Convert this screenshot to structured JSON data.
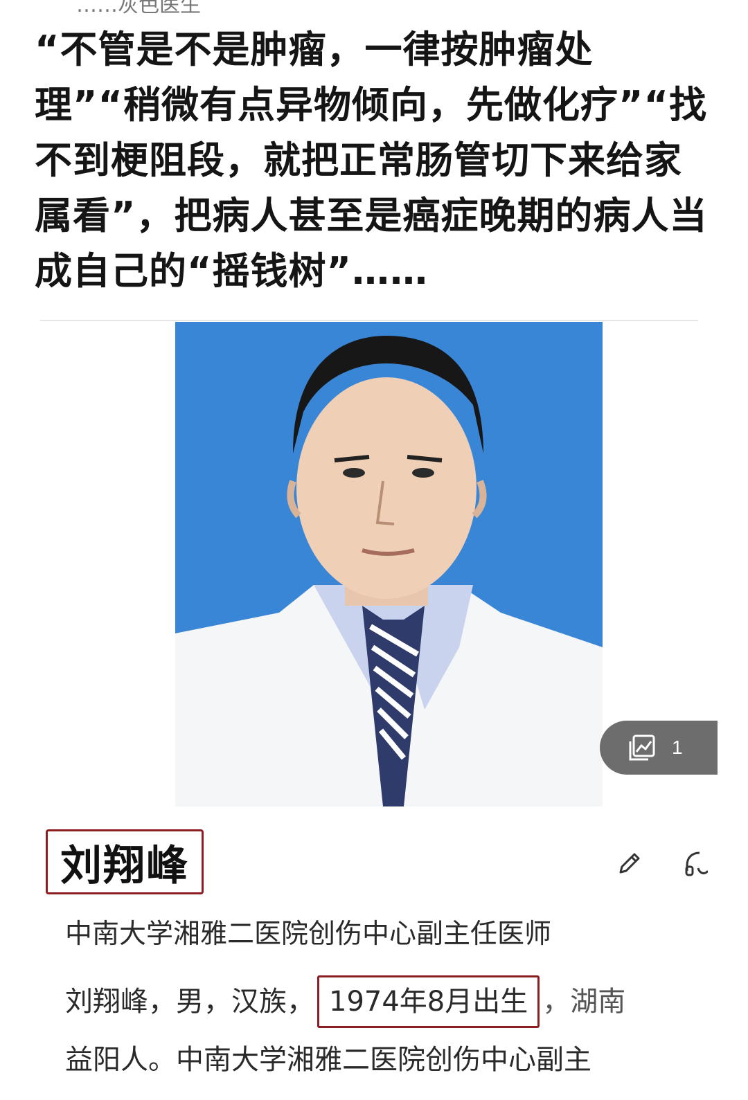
{
  "article": {
    "top_cropped_text": "……灰色医生",
    "headline": "“不管是不是肿瘤，一律按肿瘤处理”“稍微有点异物倾向，先做化疗”“找不到梗阻段，就把正常肠管切下来给家属看”，把病人甚至是癌症晚期的病人当成自己的“摇钱树”……"
  },
  "photo": {
    "background_color": "#3a86d6",
    "gallery_count": "1"
  },
  "profile": {
    "name": "刘翔峰",
    "title": "中南大学湘雅二医院创伤中心副主任医师",
    "bio_part1": "刘翔峰，男，汉族，",
    "bio_highlight": "1974年8月出生",
    "bio_part2": "，湖南",
    "bio_line2": "益阳人。中南大学湘雅二医院创伤中心副主"
  },
  "colors": {
    "highlight_border": "#8c1d22",
    "badge_bg": "#6d6d6d"
  },
  "icons": {
    "gallery": "gallery-icon",
    "edit": "pencil-icon",
    "share": "headphones-icon"
  }
}
